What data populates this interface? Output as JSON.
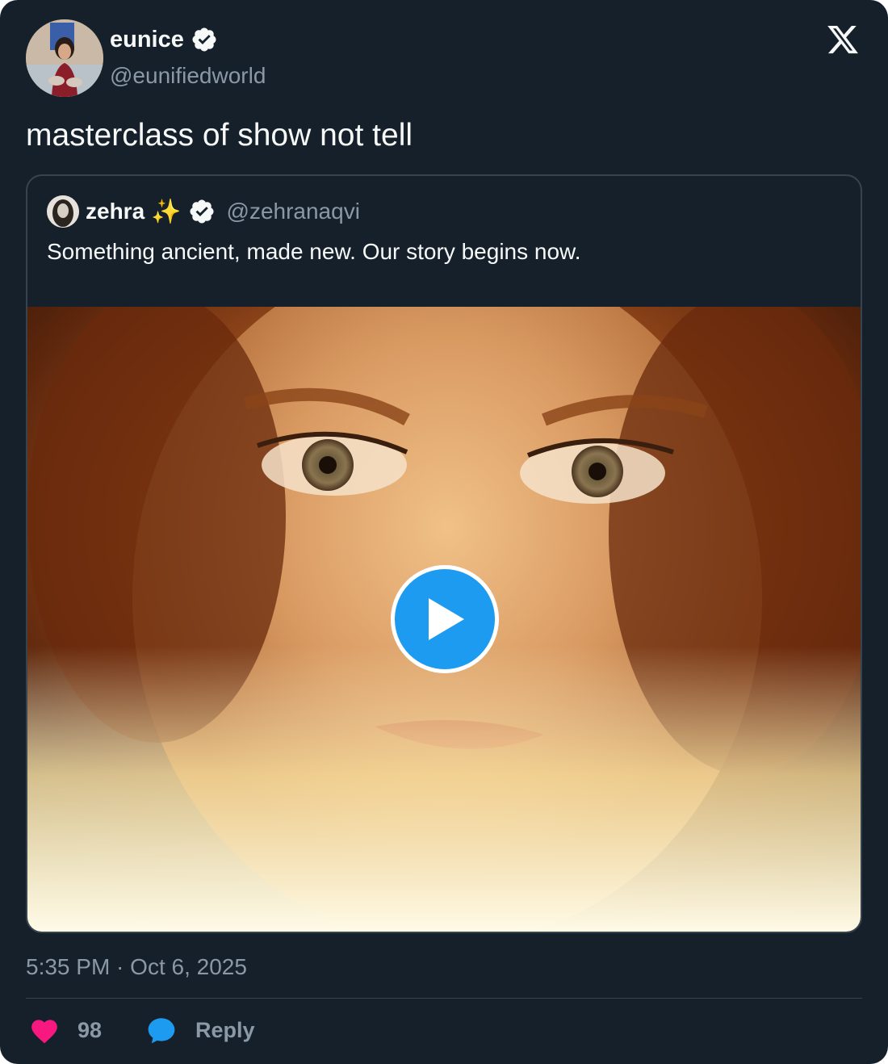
{
  "author": {
    "name": "eunice",
    "handle": "@eunifiedworld",
    "verified": true
  },
  "tweet": {
    "text": "masterclass of show not tell",
    "timestamp": "5:35 PM · Oct 6, 2025"
  },
  "quoted": {
    "name": "zehra",
    "emoji": "✨",
    "handle": "@zehranaqvi",
    "verified": true,
    "text": "Something ancient, made new. Our story begins now.",
    "media_type": "video"
  },
  "actions": {
    "like_count": "98",
    "reply_label": "Reply"
  },
  "colors": {
    "background": "#15202b",
    "text": "#f7f9f9",
    "muted": "#8b98a5",
    "border": "#38444d",
    "accent": "#1d9bf0",
    "like": "#f91880"
  },
  "icons": {
    "logo": "x-logo-icon",
    "verified": "verified-badge-icon",
    "play": "play-icon",
    "like": "heart-icon",
    "reply": "speech-bubble-icon"
  }
}
